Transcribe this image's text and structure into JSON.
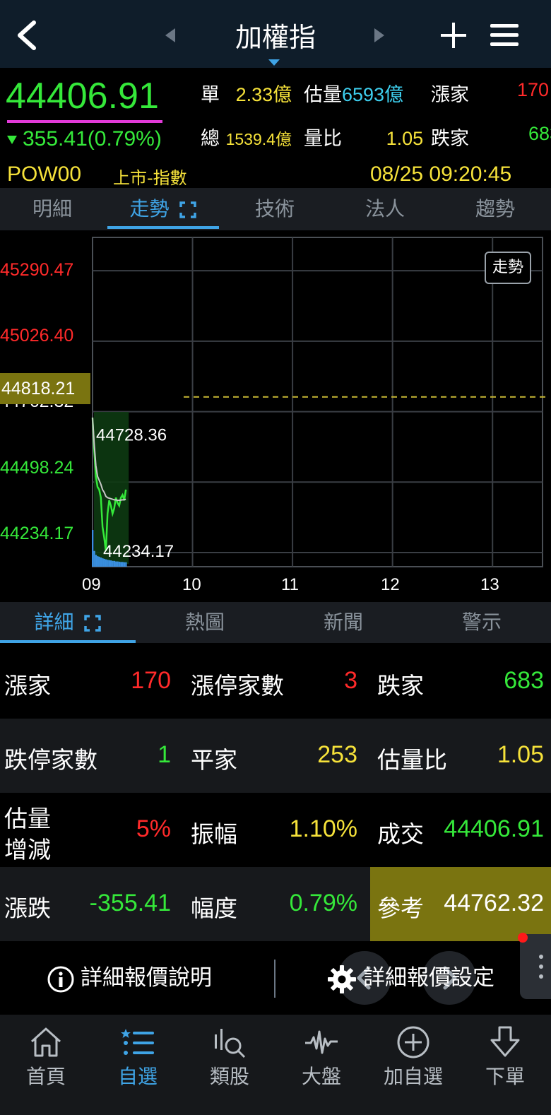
{
  "header": {
    "title": "加權指"
  },
  "quote": {
    "price": "44406.91",
    "change": "355.41",
    "change_pct": "(0.79%)",
    "code": "POW00",
    "market": "上市-指數",
    "datetime": "08/25 09:20:45",
    "single_label": "單",
    "single_value": "2.33億",
    "est_vol_label": "估量",
    "est_vol_value": "6593億",
    "up_label": "漲家",
    "up_value": "170",
    "total_label": "總",
    "total_value": "1539.4億",
    "vol_ratio_label": "量比",
    "vol_ratio_value": "1.05",
    "down_label": "跌家",
    "down_value": "683"
  },
  "tabs": [
    "明細",
    "走勢",
    "技術",
    "法人",
    "趨勢"
  ],
  "chart": {
    "y_labels": [
      "45290.47",
      "45026.40",
      "44762.32",
      "44498.24",
      "44234.17"
    ],
    "ref_tag": "44818.21",
    "high_label": "44728.36",
    "low_label": "44234.17",
    "x_labels": [
      "09",
      "10",
      "11",
      "12",
      "13"
    ],
    "badge": "走勢",
    "colors": {
      "up": "#ff2a2a",
      "down": "#35e83a",
      "ref": "#f6e23a",
      "volume": "#3a8fe0"
    }
  },
  "chart_data": {
    "type": "line",
    "x": [
      "09:00",
      "09:01",
      "09:02",
      "09:03",
      "09:04",
      "09:05",
      "09:06",
      "09:07",
      "09:08",
      "09:09",
      "09:10",
      "09:11",
      "09:12",
      "09:13",
      "09:14",
      "09:15",
      "09:16",
      "09:17",
      "09:18",
      "09:19",
      "09:20"
    ],
    "series": [
      {
        "values": [
          44740,
          44620,
          44520,
          44480,
          44470,
          44440,
          44330,
          44290,
          44240,
          44380,
          44430,
          44410,
          44380,
          44400,
          44440,
          44420,
          44410,
          44440,
          44450,
          44430,
          44470
        ]
      },
      {
        "values": [
          44740,
          44640,
          44560,
          44520,
          44505,
          44490,
          44470,
          44460,
          44445,
          44440,
          44438,
          44436,
          44434,
          44432,
          44432,
          44430,
          44430,
          44431,
          44432,
          44432,
          44434
        ]
      }
    ],
    "volume": [
      140,
      60,
      45,
      40,
      38,
      35,
      32,
      30,
      28,
      26,
      25,
      24,
      22,
      22,
      20,
      20,
      19,
      18,
      18,
      17,
      17
    ],
    "ylim": [
      44234.17,
      45290.47
    ],
    "reference": 44762.32,
    "xlim": [
      "09:00",
      "13:30"
    ]
  },
  "detail_tabs": [
    "詳細",
    "熱圖",
    "新聞",
    "警示"
  ],
  "details": {
    "r1": {
      "a_label": "漲家",
      "a_value": "170",
      "b_label": "漲停家數",
      "b_value": "3",
      "c_label": "跌家",
      "c_value": "683"
    },
    "r2": {
      "a_label": "跌停家數",
      "a_value": "1",
      "b_label": "平家",
      "b_value": "253",
      "c_label": "估量比",
      "c_value": "1.05"
    },
    "r3": {
      "a_label_1": "估量",
      "a_label_2": "增減",
      "a_value": "5%",
      "b_label": "振幅",
      "b_value": "1.10%",
      "c_label": "成交",
      "c_value": "44406.91"
    },
    "r4": {
      "a_label": "漲跌",
      "a_value": "-355.41",
      "b_label": "幅度",
      "b_value": "0.79%",
      "c_label": "參考",
      "c_value": "44762.32"
    }
  },
  "footer": {
    "info_label": "詳細報價說明",
    "settings_label": "詳細報價設定"
  },
  "bottom_nav": [
    "首頁",
    "自選",
    "類股",
    "大盤",
    "加自選",
    "下單"
  ]
}
